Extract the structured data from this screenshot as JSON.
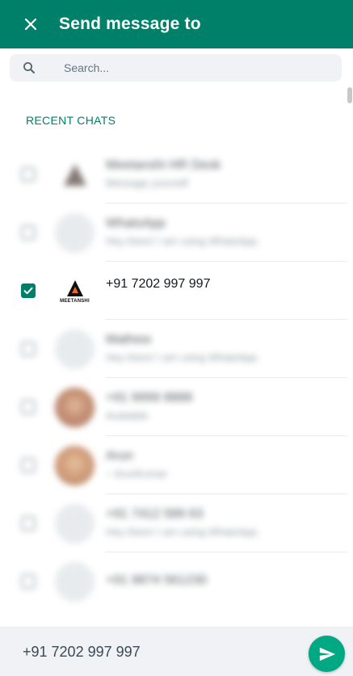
{
  "header": {
    "title": "Send message to",
    "close_icon": "close-icon"
  },
  "search": {
    "placeholder": "Search...",
    "value": "",
    "icon": "search-icon"
  },
  "section": {
    "label": "RECENT CHATS"
  },
  "chats": [
    {
      "name": "Meetanshi HR Desk",
      "subtitle": "Message yourself",
      "selected": false,
      "blurred": true,
      "avatar": "photo"
    },
    {
      "name": "WhatsApp",
      "subtitle": "Hey there! I am using WhatsApp.",
      "selected": false,
      "blurred": true,
      "avatar": "default"
    },
    {
      "name": "+91 7202 997 997",
      "subtitle": "",
      "selected": true,
      "blurred": false,
      "avatar": "logo",
      "logo_text": "MEETANSHI"
    },
    {
      "name": "Mathew",
      "subtitle": "Hey there! I am using WhatsApp.",
      "selected": false,
      "blurred": true,
      "avatar": "default"
    },
    {
      "name": "+91 9999 8888",
      "subtitle": "Available",
      "selected": false,
      "blurred": true,
      "avatar": "photo-a"
    },
    {
      "name": "Arun",
      "subtitle": "~ ArunKumar",
      "selected": false,
      "blurred": true,
      "avatar": "photo-b"
    },
    {
      "name": "+91 7412 589 63",
      "subtitle": "Hey there! I am using WhatsApp.",
      "selected": false,
      "blurred": true,
      "avatar": "default"
    },
    {
      "name": "+91 9874 561230",
      "subtitle": "",
      "selected": false,
      "blurred": true,
      "avatar": "default"
    }
  ],
  "footer": {
    "selected_text": "+91 7202 997 997",
    "send_icon": "send-icon"
  },
  "colors": {
    "brand": "#008069",
    "accent": "#00a884",
    "panel": "#f0f2f5"
  }
}
